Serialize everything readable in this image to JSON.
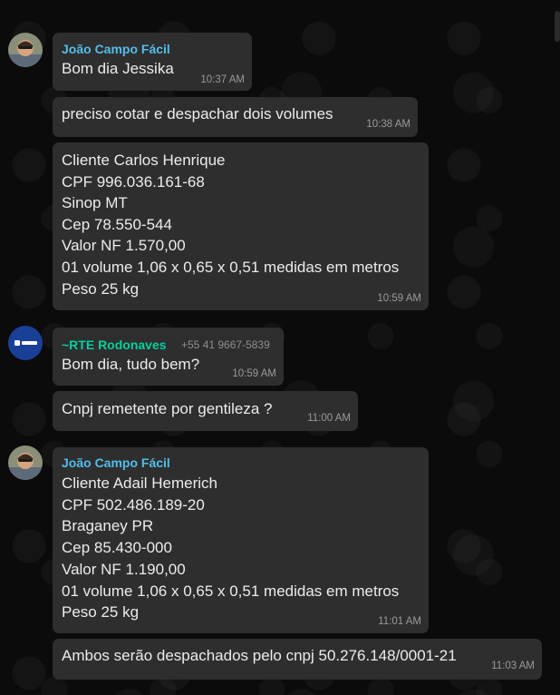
{
  "theme": {
    "background": "#0b0b0b",
    "bubble": "#2e2e2e",
    "sender_joao_color": "#53bdeb",
    "sender_rte_color": "#06cf9c",
    "text_color": "#ececec",
    "time_color": "#9a9a9a"
  },
  "messages": [
    {
      "sender": "João Campo Fácil",
      "lines": [
        "Bom dia Jessika"
      ],
      "time": "10:37 AM"
    },
    {
      "lines": [
        "preciso cotar e despachar dois volumes"
      ],
      "time": "10:38 AM"
    },
    {
      "lines": [
        "Cliente Carlos Henrique",
        "CPF 996.036.161-68",
        "Sinop MT",
        "Cep 78.550-544",
        "Valor NF 1.570,00",
        "01 volume 1,06 x 0,65 x 0,51 medidas em metros",
        "Peso 25 kg"
      ],
      "time": "10:59 AM"
    },
    {
      "sender": "~RTE Rodonaves",
      "phone": "+55 41 9667-5839",
      "lines": [
        "Bom dia, tudo bem?"
      ],
      "time": "10:59 AM"
    },
    {
      "lines": [
        "Cnpj remetente por gentileza ?"
      ],
      "time": "11:00 AM"
    },
    {
      "sender": "João Campo Fácil",
      "lines": [
        "Cliente Adail Hemerich",
        "CPF 502.486.189-20",
        "Braganey PR",
        "Cep 85.430-000",
        "Valor NF 1.190,00",
        "01 volume 1,06 x 0,65 x 0,51 medidas em metros",
        "Peso 25 kg"
      ],
      "time": "11:01 AM"
    },
    {
      "lines": [
        "Ambos serão despachados pelo cnpj 50.276.148/0001-21"
      ],
      "time": "11:03 AM"
    }
  ],
  "avatars": {
    "joao": "user-avatar-icon",
    "rte": "rodonaves-logo-icon"
  }
}
